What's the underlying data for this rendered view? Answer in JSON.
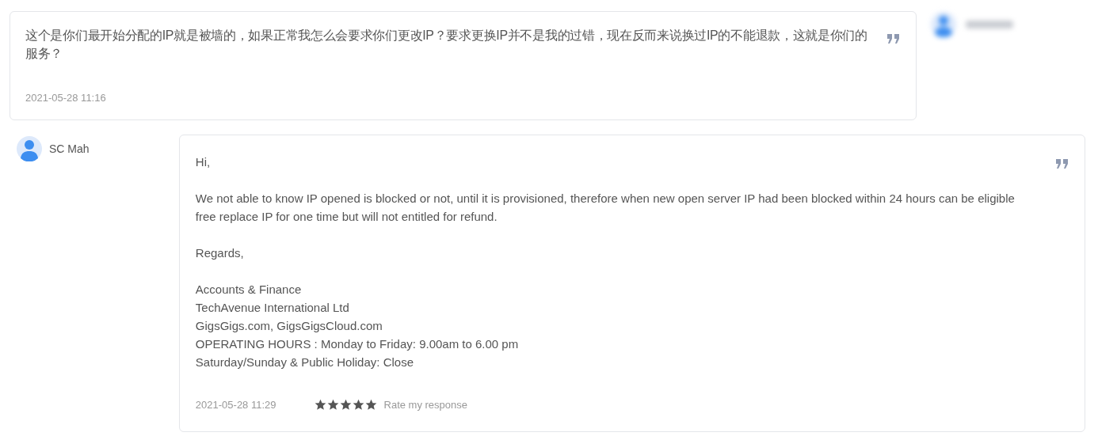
{
  "messages": [
    {
      "kind": "customer",
      "text": "这个是你们最开始分配的IP就是被墙的，如果正常我怎么会要求你们更改IP？要求更换IP并不是我的过错，现在反而来说换过IP的不能退款，这就是你们的服务？",
      "time": "2021-05-28 11:16"
    },
    {
      "kind": "staff",
      "author": "SC Mah",
      "paragraphs": [
        [
          "Hi,"
        ],
        [
          "We not able to know IP opened is blocked or not, until it is provisioned, therefore when new open server IP had been blocked within 24 hours can be eligible free replace IP for one time but will not entitled for refund."
        ],
        [
          "Regards,"
        ],
        [
          "Accounts & Finance",
          "TechAvenue International Ltd",
          "GigsGigs.com, GigsGigsCloud.com",
          "OPERATING HOURS : Monday to Friday: 9.00am to 6.00 pm",
          "Saturday/Sunday & Public Holiday: Close"
        ]
      ],
      "time": "2021-05-28 11:29",
      "stars": 5,
      "rate_label": "Rate my response"
    }
  ]
}
